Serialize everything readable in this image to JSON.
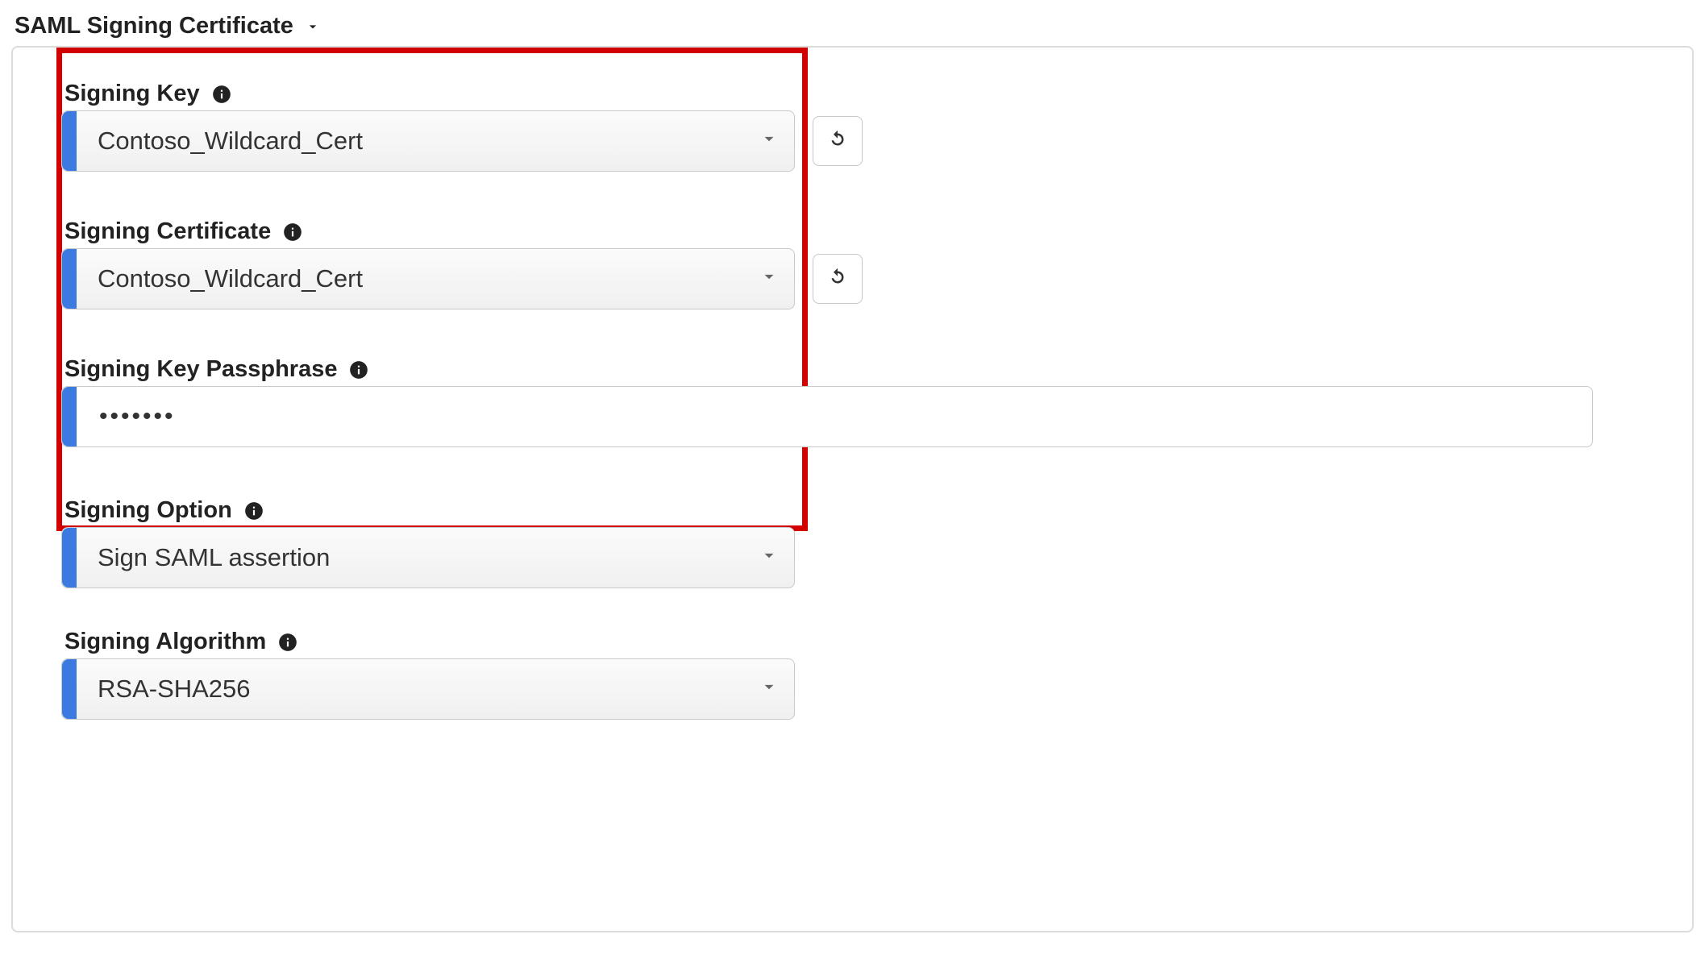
{
  "header": {
    "title": "SAML Signing Certificate"
  },
  "fields": {
    "signingKey": {
      "label": "Signing Key",
      "value": "Contoso_Wildcard_Cert"
    },
    "signingCertificate": {
      "label": "Signing Certificate",
      "value": "Contoso_Wildcard_Cert"
    },
    "signingKeyPassphrase": {
      "label": "Signing Key Passphrase",
      "value": "•••••••"
    },
    "signingOption": {
      "label": "Signing Option",
      "value": "Sign SAML assertion"
    },
    "signingAlgorithm": {
      "label": "Signing Algorithm",
      "value": "RSA-SHA256"
    }
  }
}
